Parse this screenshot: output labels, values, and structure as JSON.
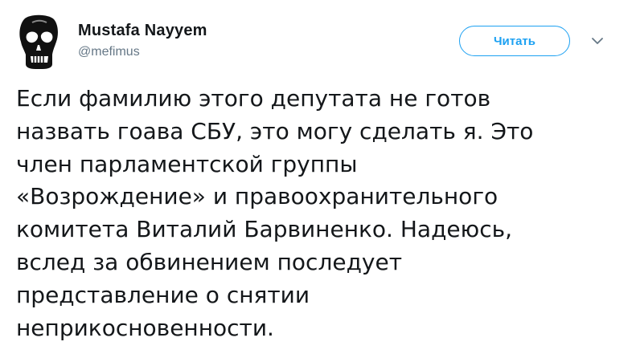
{
  "author": {
    "display_name": "Mustafa Nayyem",
    "handle": "@mefimus"
  },
  "actions": {
    "follow_label": "Читать"
  },
  "icons": {
    "avatar": "skull-avatar-icon",
    "menu": "chevron-down-icon"
  },
  "colors": {
    "accent": "#1da1f2",
    "text": "#14171a",
    "secondary_text": "#657786"
  },
  "tweet": {
    "text": "Если фамилию этого депутата не готов\nназвать гоава СБУ, это могу сделать я. Это\nчлен парламентской группы\n«Возрождение» и правоохранительного\nкомитета Виталий Барвиненко. Надеюсь,\nвслед за обвинением последует\nпредставление о снятии\nнеприкосновенности."
  }
}
